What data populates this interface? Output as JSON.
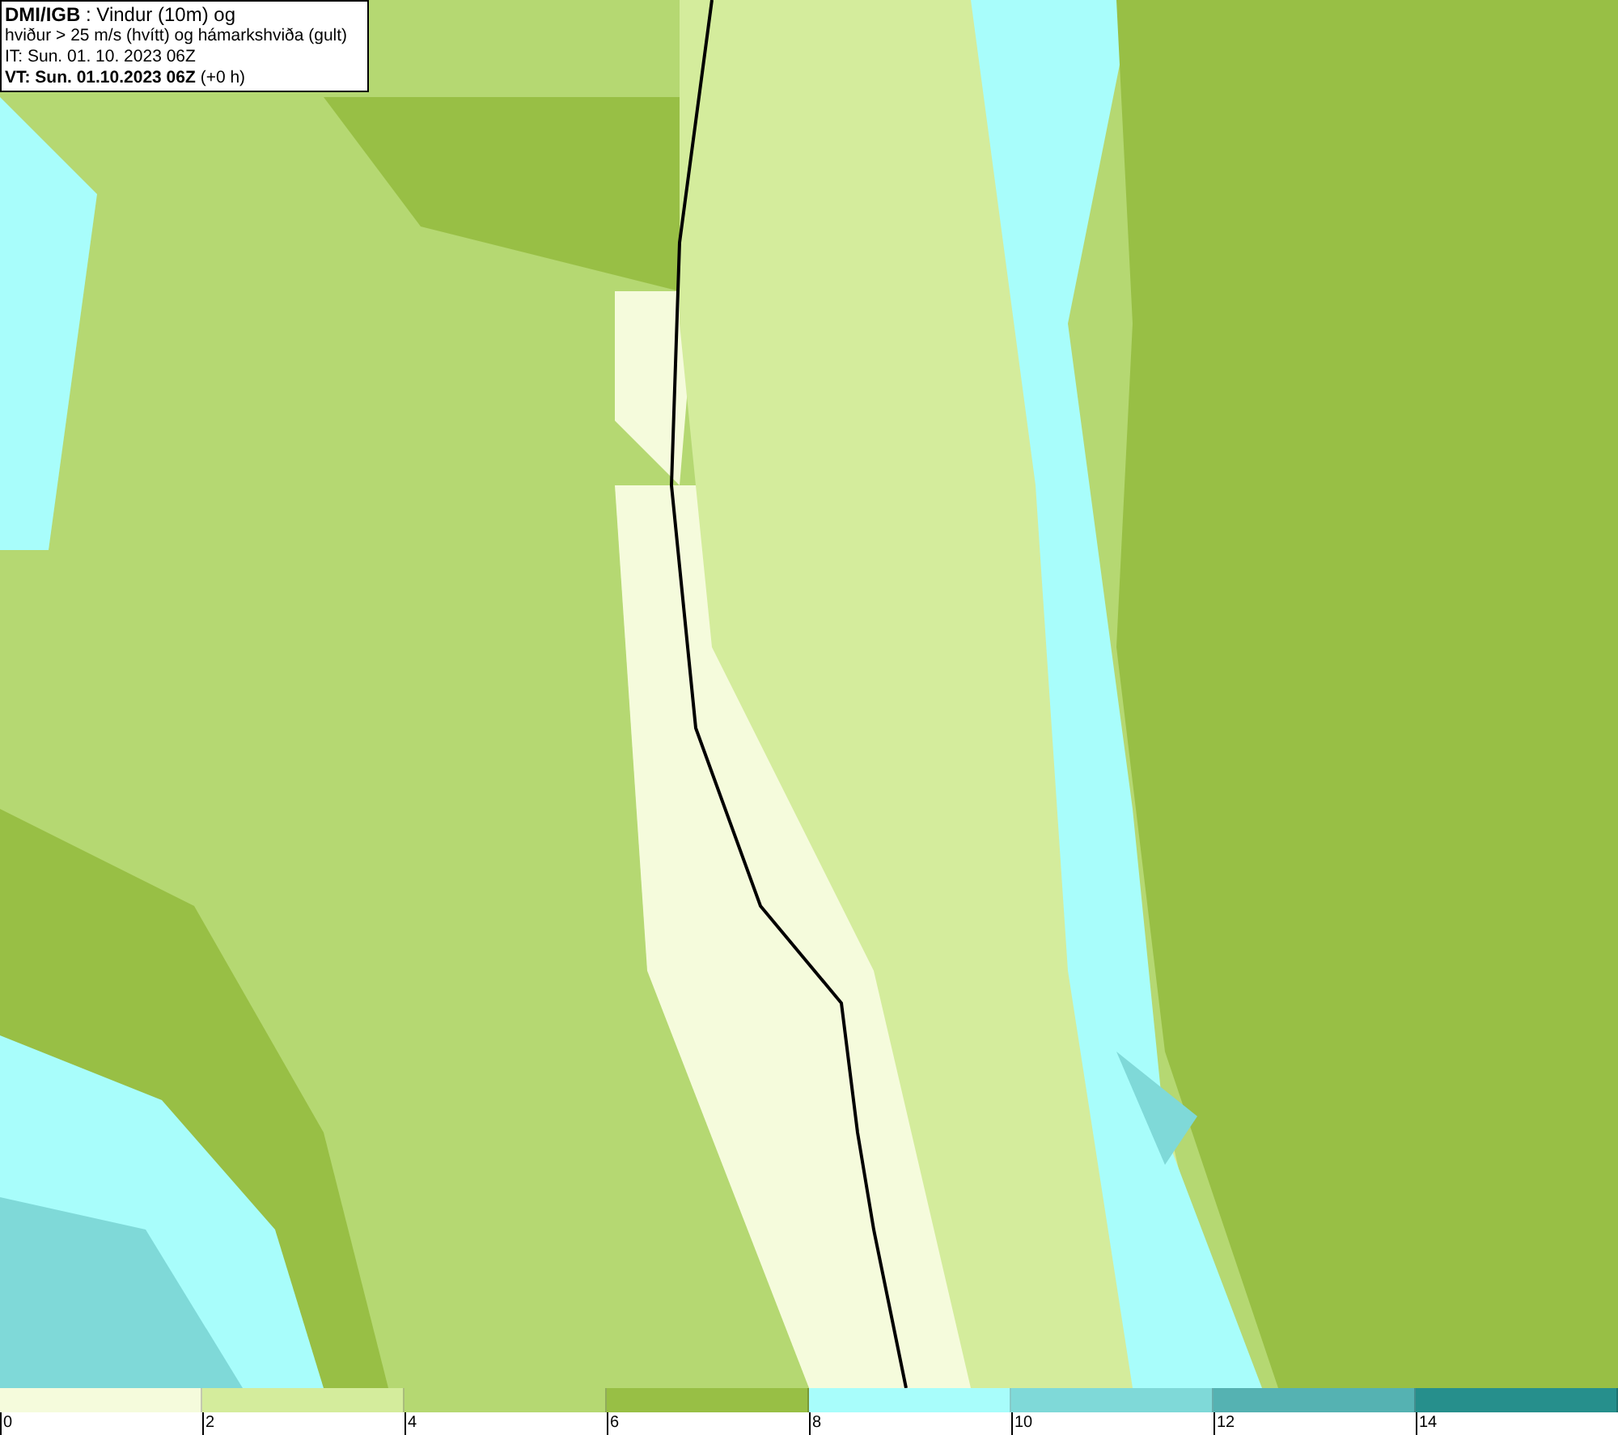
{
  "title_box": {
    "lines": [
      "**DMI/IGB** : Vindur (10m) og",
      "hviður > 25 m/s (hvítt) og hámarkshviða (gult)",
      "IT: Sun. 01. 10. 2023 06Z",
      "**VT: Sun. 01.10.2023 06Z** (+0 h)"
    ]
  },
  "legend": [
    {
      "label": "0",
      "color": "#f5fbdc"
    },
    {
      "label": "2",
      "color": "#d4ec9c"
    },
    {
      "label": "4",
      "color": "#b5d872"
    },
    {
      "label": "6",
      "color": "#98bf45"
    },
    {
      "label": "8",
      "color": "#a8fdfb"
    },
    {
      "label": "10",
      "color": "#7fd9d8"
    },
    {
      "label": "12",
      "color": "#55b2b2"
    },
    {
      "label": "14",
      "color": "#268f8c"
    }
  ]
}
